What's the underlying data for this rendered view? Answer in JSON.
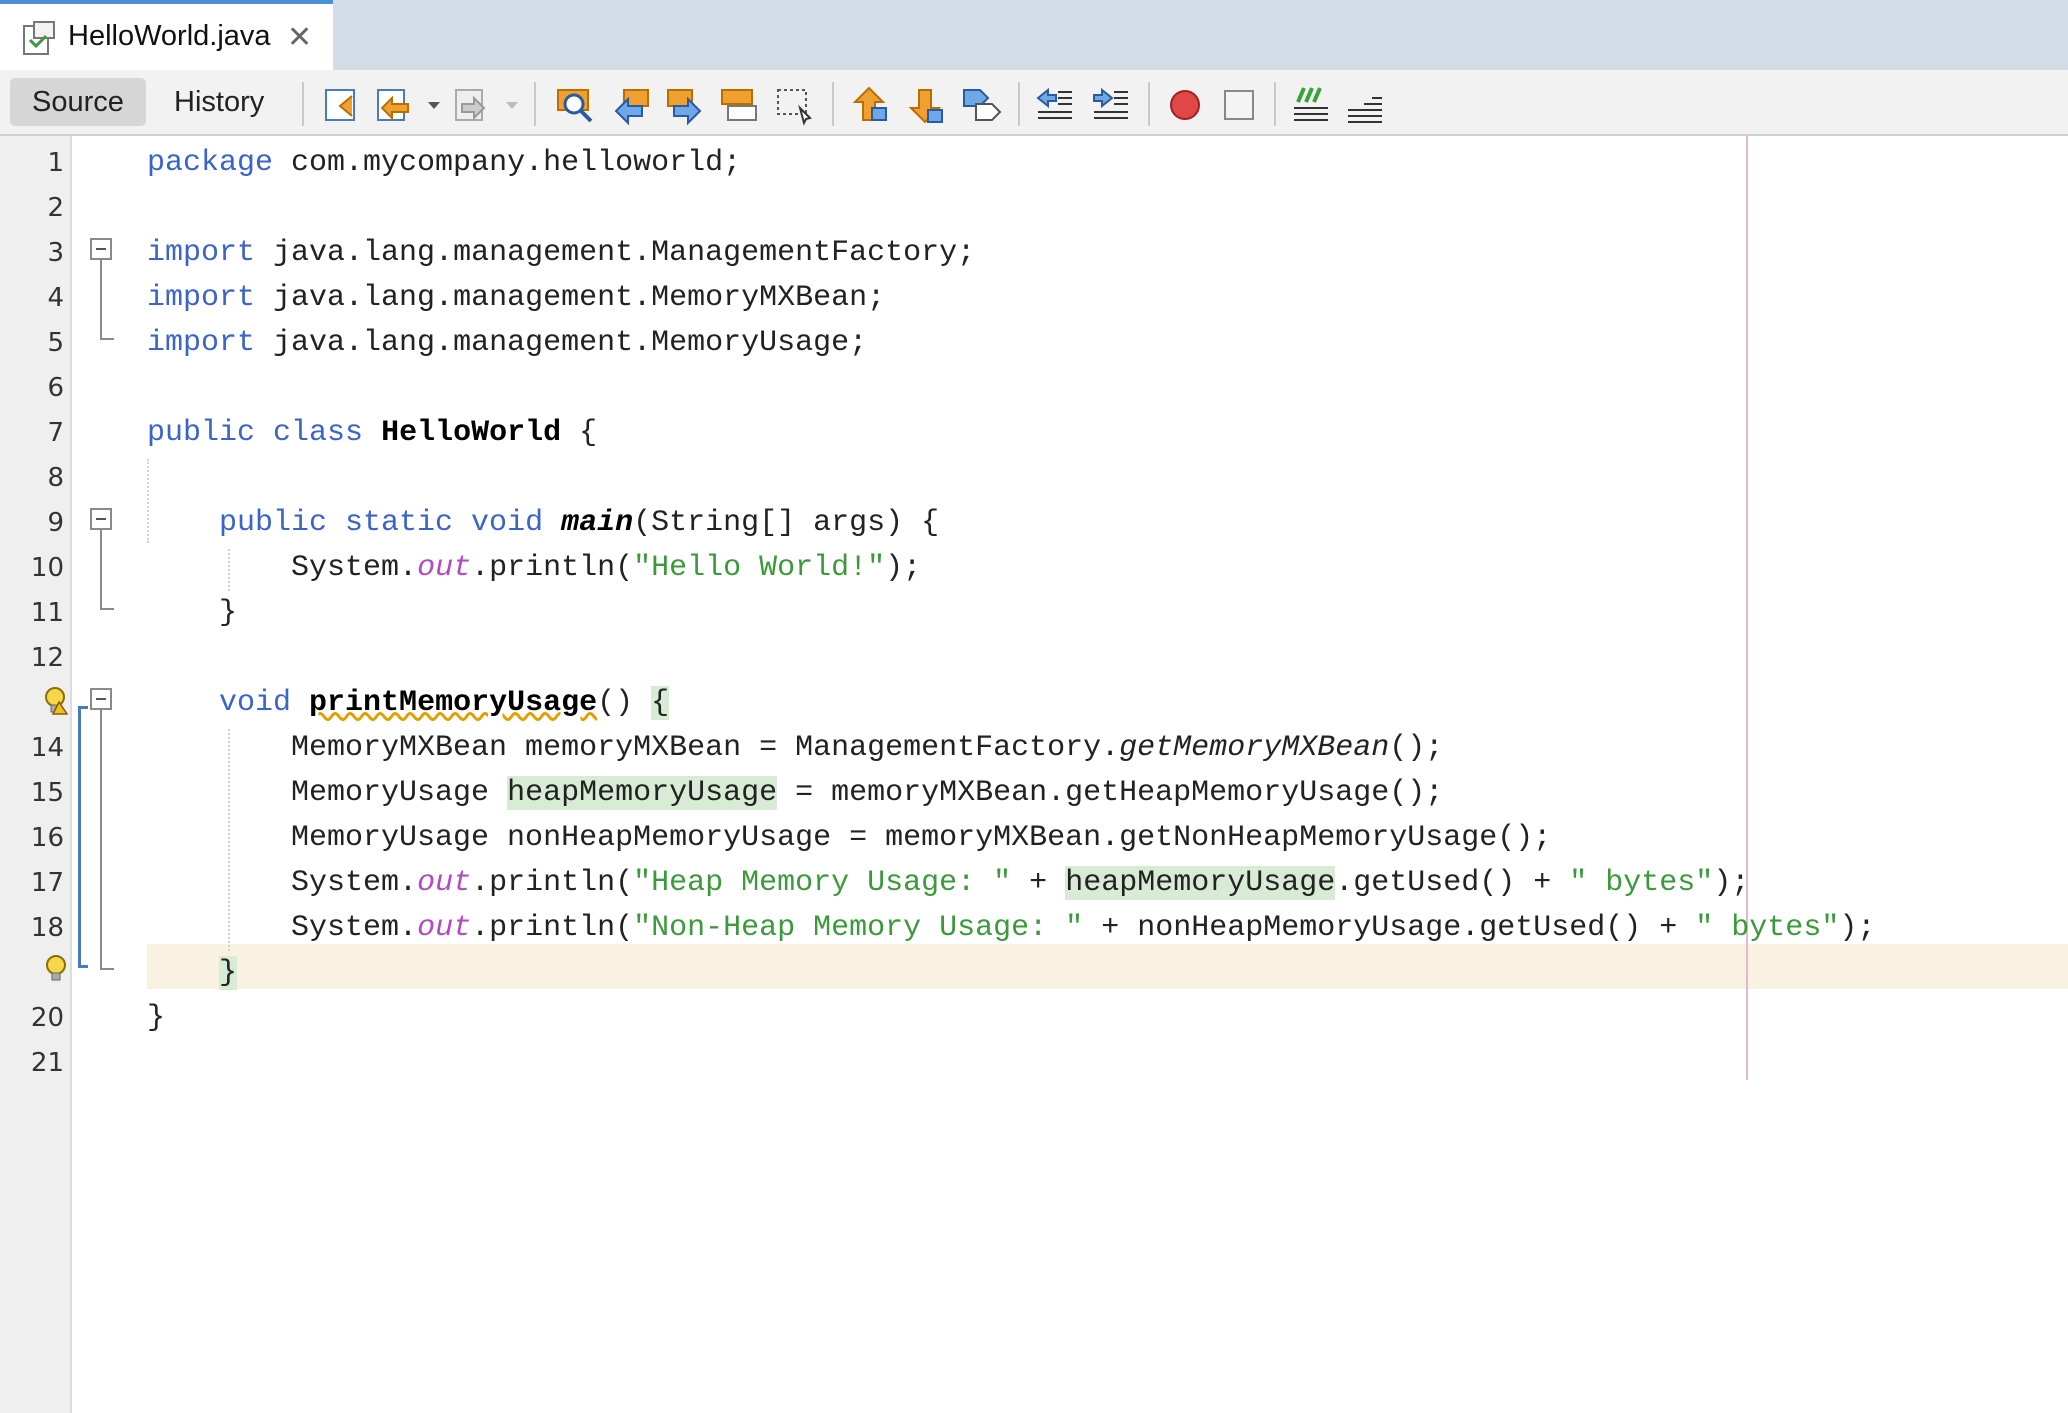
{
  "tab": {
    "title": "HelloWorld.java",
    "close": "✕"
  },
  "toolbar": {
    "source_label": "Source",
    "history_label": "History",
    "icons": [
      "last-edit-icon",
      "back-icon",
      "forward-icon",
      "find-icon",
      "find-previous-icon",
      "find-next-icon",
      "toggle-highlight-icon",
      "toggle-rectangular-selection-icon",
      "previous-bookmark-icon",
      "next-bookmark-icon",
      "toggle-bookmark-icon",
      "shift-left-icon",
      "shift-right-icon",
      "start-macro-icon",
      "stop-macro-icon",
      "comment-icon",
      "uncomment-icon"
    ]
  },
  "line_numbers": [
    "1",
    "2",
    "3",
    "4",
    "5",
    "6",
    "7",
    "8",
    "9",
    "10",
    "11",
    "12",
    "14",
    "15",
    "16",
    "17",
    "18",
    "20",
    "21"
  ],
  "code": {
    "l1": {
      "kw": "package",
      "rest": " com.mycompany.helloworld;"
    },
    "l3": {
      "kw": "import",
      "rest": " java.lang.management.ManagementFactory;"
    },
    "l4": {
      "kw": "import",
      "rest": " java.lang.management.MemoryMXBean;"
    },
    "l5": {
      "kw": "import",
      "rest": " java.lang.management.MemoryUsage;"
    },
    "l7": {
      "kw": "public class",
      "name": "HelloWorld",
      "rest": " {"
    },
    "l9": {
      "indent": "    ",
      "kw": "public static void",
      "name": "main",
      "rest": "(String[] args) {"
    },
    "l10": {
      "indent": "        ",
      "a": "System.",
      "fld": "out",
      "b": ".println(",
      "str": "\"Hello World!\"",
      "c": ");"
    },
    "l11": {
      "text": "    }"
    },
    "l13": {
      "indent": "    ",
      "kw": "void",
      "name": "printMemoryUsage",
      "rest": "() ",
      "brace": "{"
    },
    "l14": {
      "a": "        MemoryMXBean memoryMXBean = ManagementFactory.",
      "it": "getMemoryMXBean",
      "b": "();"
    },
    "l15": {
      "a": "        MemoryUsage ",
      "hl": "heapMemoryUsage",
      "b": " = memoryMXBean.getHeapMemoryUsage();"
    },
    "l16": {
      "text": "        MemoryUsage nonHeapMemoryUsage = memoryMXBean.getNonHeapMemoryUsage();"
    },
    "l17": {
      "indent": "        ",
      "a": "System.",
      "fld": "out",
      "b": ".println(",
      "str": "\"Heap Memory Usage: \"",
      "c": " + ",
      "hl": "heapMemoryUsage",
      "d": ".getUsed() + ",
      "str2": "\" bytes\"",
      "e": ");"
    },
    "l18": {
      "indent": "        ",
      "a": "System.",
      "fld": "out",
      "b": ".println(",
      "str": "\"Non-Heap Memory Usage: \"",
      "c": " + nonHeapMemoryUsage.getUsed() + ",
      "str2": "\" bytes\"",
      "e": ");"
    },
    "l19": {
      "indent": "    ",
      "brace": "}"
    },
    "l20": {
      "text": "}"
    }
  }
}
